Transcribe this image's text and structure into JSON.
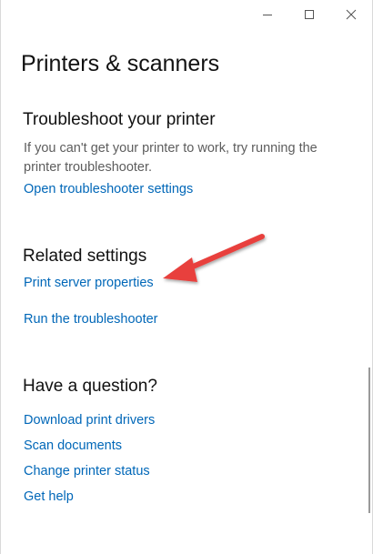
{
  "window": {
    "title": "Printers & scanners",
    "controls": [
      "minimize-icon",
      "maximize-icon",
      "close-icon"
    ]
  },
  "troubleshoot": {
    "heading": "Troubleshoot your printer",
    "description": "If you can't get your printer to work, try running the printer troubleshooter.",
    "link": "Open troubleshooter settings"
  },
  "related": {
    "heading": "Related settings",
    "links": [
      "Print server properties",
      "Run the troubleshooter"
    ]
  },
  "question": {
    "heading": "Have a question?",
    "links": [
      "Download print drivers",
      "Scan documents",
      "Change printer status",
      "Get help"
    ]
  },
  "colors": {
    "link": "#0067b8",
    "text": "#111111",
    "secondary_text": "#5d5d5d",
    "annotation_arrow": "#e8413e"
  }
}
